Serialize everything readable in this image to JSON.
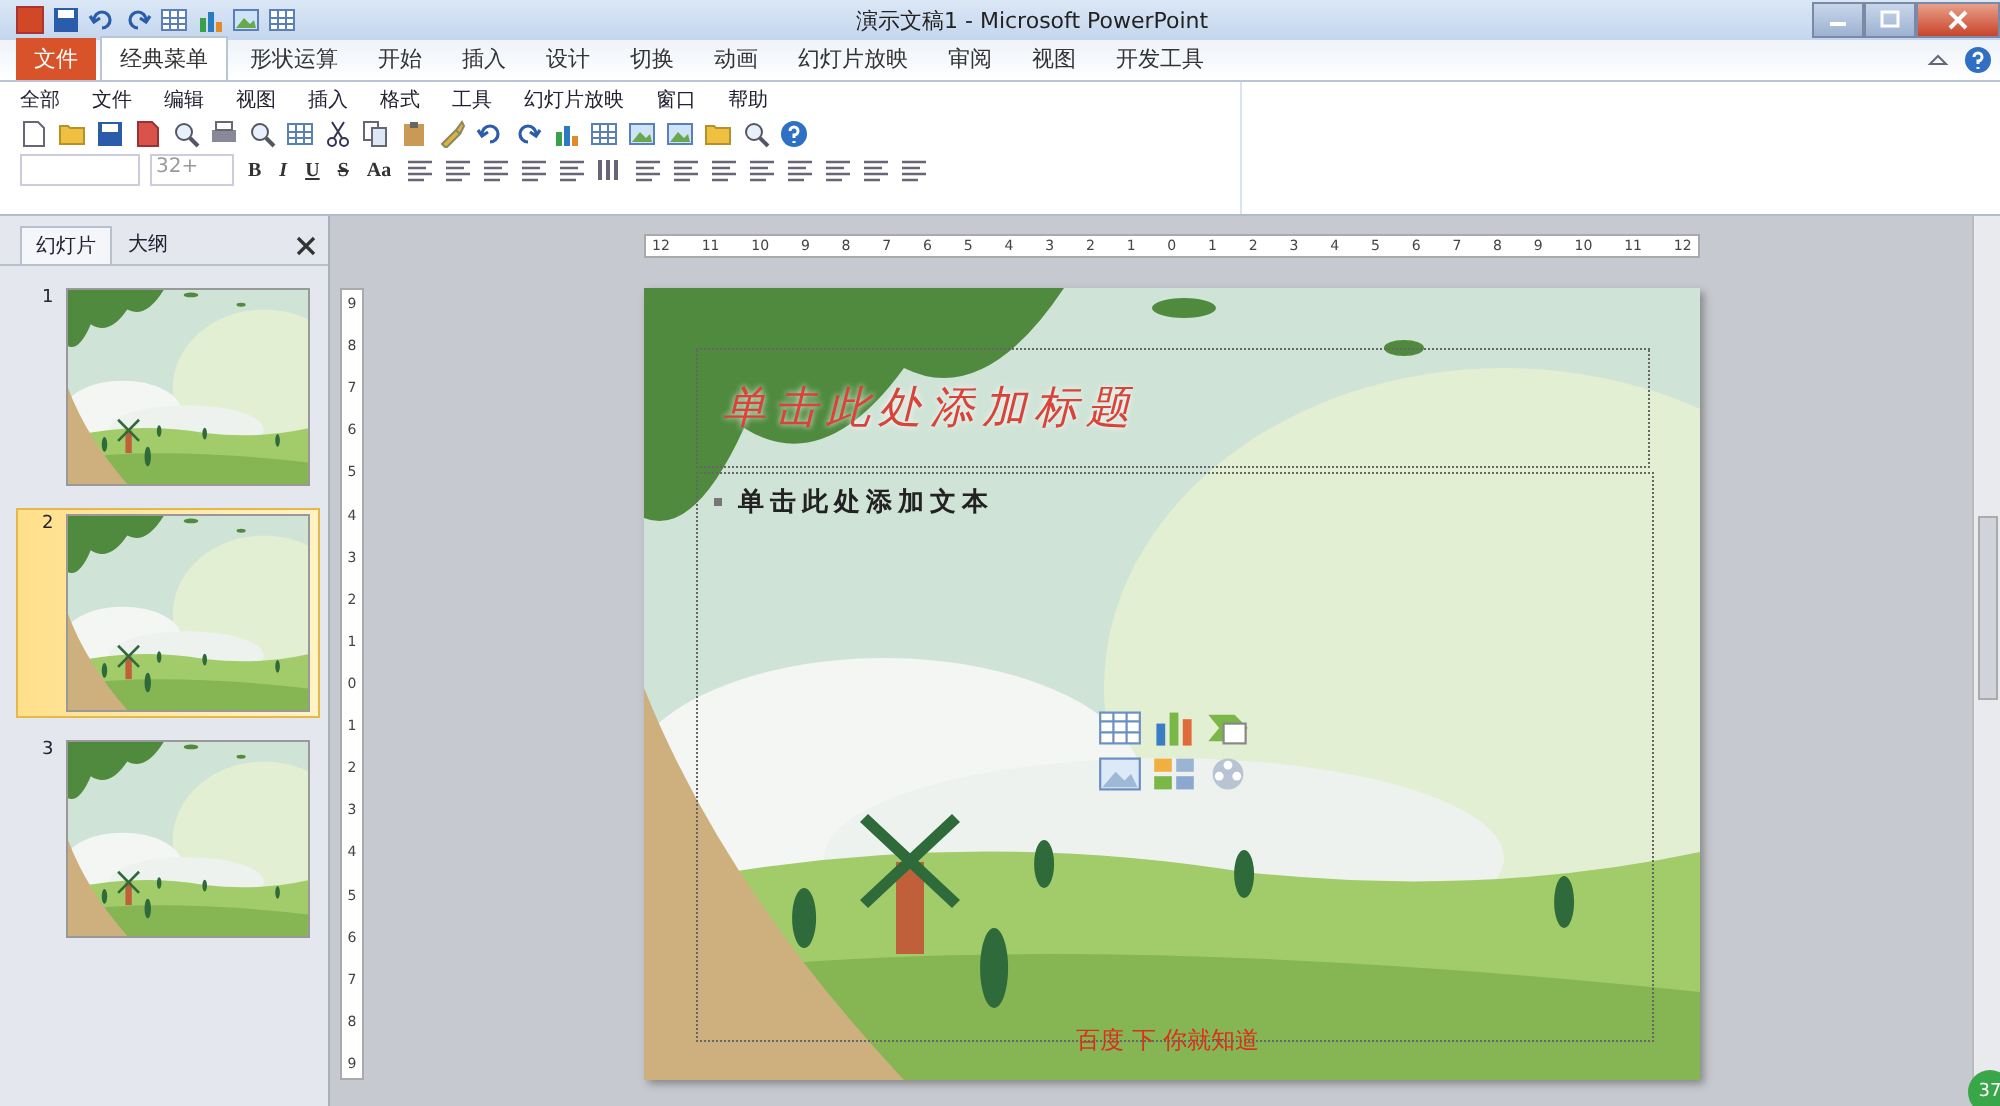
{
  "window": {
    "title": "演示文稿1 - Microsoft PowerPoint"
  },
  "ribbon_tabs": [
    {
      "label": "文件",
      "kind": "file",
      "selected": false
    },
    {
      "label": "经典菜单",
      "kind": "tab",
      "selected": true
    },
    {
      "label": "形状运算",
      "kind": "tab",
      "selected": false
    },
    {
      "label": "开始",
      "kind": "tab",
      "selected": false
    },
    {
      "label": "插入",
      "kind": "tab",
      "selected": false
    },
    {
      "label": "设计",
      "kind": "tab",
      "selected": false
    },
    {
      "label": "切换",
      "kind": "tab",
      "selected": false
    },
    {
      "label": "动画",
      "kind": "tab",
      "selected": false
    },
    {
      "label": "幻灯片放映",
      "kind": "tab",
      "selected": false
    },
    {
      "label": "审阅",
      "kind": "tab",
      "selected": false
    },
    {
      "label": "视图",
      "kind": "tab",
      "selected": false
    },
    {
      "label": "开发工具",
      "kind": "tab",
      "selected": false
    }
  ],
  "menus": [
    "全部",
    "文件",
    "编辑",
    "视图",
    "插入",
    "格式",
    "工具",
    "幻灯片放映",
    "窗口",
    "帮助"
  ],
  "font_size": {
    "value": "32+"
  },
  "format_buttons": [
    "B",
    "I",
    "U",
    "S",
    "Aa"
  ],
  "panel_tabs": [
    {
      "label": "幻灯片",
      "selected": true
    },
    {
      "label": "大纲",
      "selected": false
    }
  ],
  "slides": [
    {
      "number": "1",
      "selected": false
    },
    {
      "number": "2",
      "selected": true
    },
    {
      "number": "3",
      "selected": false
    }
  ],
  "rulers": {
    "horizontal": [
      "12",
      "11",
      "10",
      "9",
      "8",
      "7",
      "6",
      "5",
      "4",
      "3",
      "2",
      "1",
      "0",
      "1",
      "2",
      "3",
      "4",
      "5",
      "6",
      "7",
      "8",
      "9",
      "10",
      "11",
      "12"
    ],
    "vertical": [
      "9",
      "8",
      "7",
      "6",
      "5",
      "4",
      "3",
      "2",
      "1",
      "0",
      "1",
      "2",
      "3",
      "4",
      "5",
      "6",
      "7",
      "8",
      "9"
    ]
  },
  "slide": {
    "title_placeholder": "单击此处添加标题",
    "body_placeholder": "单击此处添加文本",
    "footer": "百度 下 你就知道"
  },
  "badge": "37"
}
